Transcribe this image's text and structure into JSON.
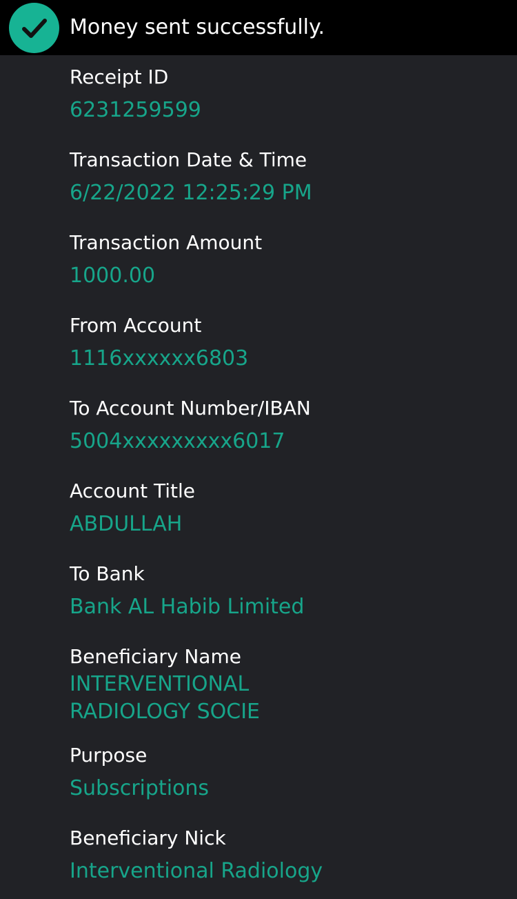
{
  "banner": {
    "message": "Money sent successfully.",
    "icon": "check-circle-icon",
    "accent_color": "#17B394"
  },
  "receipt": {
    "receipt_id_label": "Receipt ID",
    "receipt_id": "6231259599",
    "datetime_label": "Transaction Date & Time",
    "datetime": "6/22/2022 12:25:29 PM",
    "amount_label": "Transaction Amount",
    "amount": "1000.00",
    "from_account_label": "From Account",
    "from_account": "1116xxxxxx6803",
    "to_account_label": "To Account Number/IBAN",
    "to_account": "5004xxxxxxxxx6017",
    "account_title_label": "Account Title",
    "account_title": "ABDULLAH",
    "to_bank_label": "To Bank",
    "to_bank": "Bank AL Habib Limited",
    "beneficiary_name_label": "Beneficiary Name",
    "beneficiary_name_line1": "INTERVENTIONAL",
    "beneficiary_name_line2": "RADIOLOGY SOCIE",
    "purpose_label": "Purpose",
    "purpose": "Subscriptions",
    "beneficiary_nick_label": "Beneficiary Nick",
    "beneficiary_nick": "Interventional Radiology"
  },
  "colors": {
    "background": "#212226",
    "value_text": "#17A58A",
    "label_text": "#FFFFFF"
  }
}
